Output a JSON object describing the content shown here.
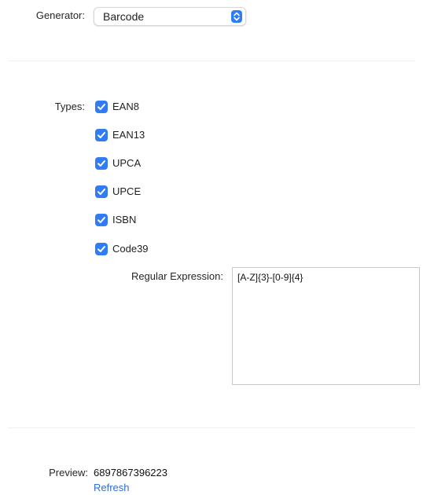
{
  "generator": {
    "label": "Generator:",
    "value": "Barcode",
    "stepper_icon": "up-down-chevron-icon",
    "accent_color": "#2f7cf6"
  },
  "types": {
    "label": "Types:",
    "items": [
      {
        "label": "EAN8",
        "checked": true
      },
      {
        "label": "EAN13",
        "checked": true
      },
      {
        "label": "UPCA",
        "checked": true
      },
      {
        "label": "UPCE",
        "checked": true
      },
      {
        "label": "ISBN",
        "checked": true
      },
      {
        "label": "Code39",
        "checked": true
      }
    ],
    "checkbox_icon": "checkmark-icon"
  },
  "regex": {
    "label": "Regular Expression:",
    "value": "[A-Z]{3}-[0-9]{4}"
  },
  "preview": {
    "label": "Preview:",
    "value": "6897867396223",
    "refresh_label": "Refresh",
    "link_color": "#2f6fd6"
  }
}
